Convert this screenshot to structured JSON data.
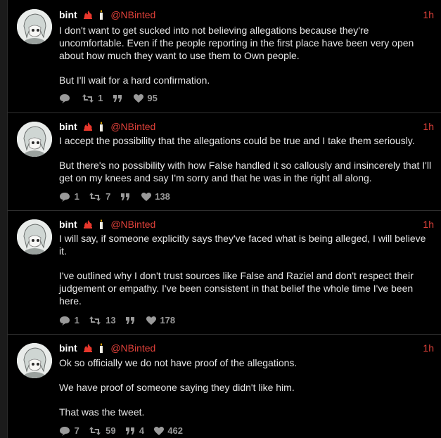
{
  "accent": "#e0413a",
  "tweets": [
    {
      "name": "bint",
      "handle": "@NBinted",
      "time": "1h",
      "paragraphs": [
        "I don't want to get sucked into not believing allegations because they're uncomfortable. Even if the people reporting in the first place have been very open about how much they want to use them to Own people.",
        "But I'll wait for a hard confirmation."
      ],
      "replies": "",
      "retweets": "1",
      "quotes": "",
      "likes": "95"
    },
    {
      "name": "bint",
      "handle": "@NBinted",
      "time": "1h",
      "paragraphs": [
        "I accept the possibility that the allegations could be true and I take them seriously.",
        "But there's no possibility with how False handled it so callously and insincerely that I'll get on my knees and say I'm sorry and that he was in the right all along."
      ],
      "replies": "1",
      "retweets": "7",
      "quotes": "",
      "likes": "138"
    },
    {
      "name": "bint",
      "handle": "@NBinted",
      "time": "1h",
      "paragraphs": [
        "I will say, if someone explicitly says they've faced what is being alleged, I will believe it.",
        "I've outlined why I don't trust sources like False and Raziel and don't respect their judgement or empathy. I've been consistent in that belief the whole time I've been here."
      ],
      "replies": "1",
      "retweets": "13",
      "quotes": "",
      "likes": "178"
    },
    {
      "name": "bint",
      "handle": "@NBinted",
      "time": "1h",
      "paragraphs": [
        "Ok so officially we do not have proof of the allegations.",
        "We have proof of someone saying they didn't like him.",
        "That was the tweet."
      ],
      "replies": "7",
      "retweets": "59",
      "quotes": "4",
      "likes": "462"
    }
  ]
}
